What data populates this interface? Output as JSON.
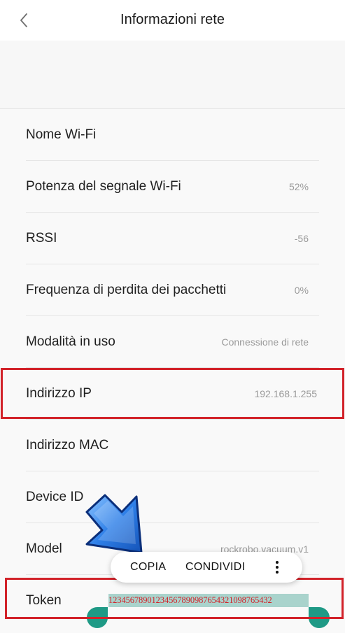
{
  "header": {
    "title": "Informazioni rete"
  },
  "rows": [
    {
      "label": "Nome Wi-Fi",
      "value": ""
    },
    {
      "label": "Potenza del segnale Wi-Fi",
      "value": "52%"
    },
    {
      "label": "RSSI",
      "value": "-56"
    },
    {
      "label": "Frequenza di perdita dei pacchetti",
      "value": "0%"
    },
    {
      "label": "Modalità in uso",
      "value": "Connessione di rete"
    },
    {
      "label": "Indirizzo IP",
      "value": "192.168.1.255"
    },
    {
      "label": "Indirizzo MAC",
      "value": ""
    },
    {
      "label": "Device ID",
      "value": ""
    },
    {
      "label": "Model",
      "value": "rockrobo.vacuum.v1"
    },
    {
      "label": "Token",
      "value": "12345678901234567890987654321098765432"
    }
  ],
  "context_menu": {
    "copy_label": "COPIA",
    "share_label": "CONDIVIDI"
  },
  "annotations": {
    "highlight_color": "#d2232a",
    "arrow_color": "#1e6fd9",
    "selection_color": "#a9d3cc",
    "handle_color": "#1f9a86"
  }
}
